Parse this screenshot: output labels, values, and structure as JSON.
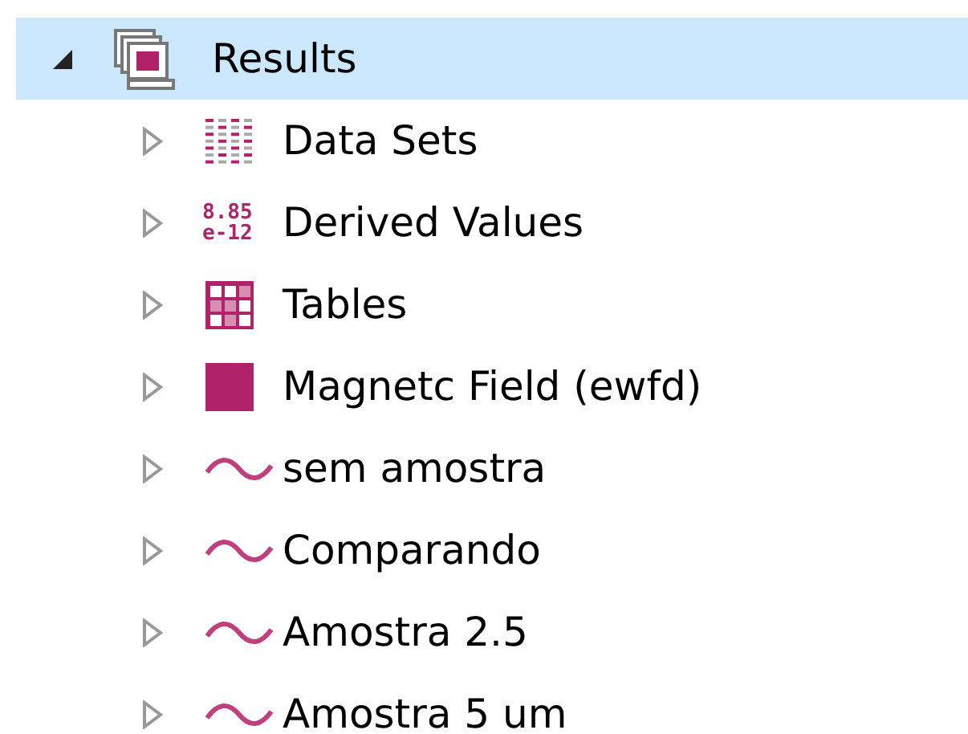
{
  "tree": {
    "label": "Results",
    "kind": "results",
    "expanded": true,
    "selected": true,
    "children": [
      {
        "label": "Data Sets",
        "kind": "datasets",
        "expanded": false,
        "selected": false
      },
      {
        "label": "Derived Values",
        "kind": "derived",
        "icon_text": [
          "8.85",
          "e-12"
        ],
        "expanded": false,
        "selected": false
      },
      {
        "label": "Tables",
        "kind": "tables",
        "expanded": false,
        "selected": false
      },
      {
        "label": "Magnetc Field (ewfd)",
        "kind": "plot",
        "expanded": false,
        "selected": false
      },
      {
        "label": "sem amostra",
        "kind": "wave",
        "expanded": false,
        "selected": false
      },
      {
        "label": "Comparando",
        "kind": "wave",
        "expanded": false,
        "selected": false
      },
      {
        "label": "Amostra 2.5",
        "kind": "wave",
        "expanded": false,
        "selected": false
      },
      {
        "label": "Amostra 5 um",
        "kind": "wave",
        "expanded": false,
        "selected": false
      }
    ]
  }
}
